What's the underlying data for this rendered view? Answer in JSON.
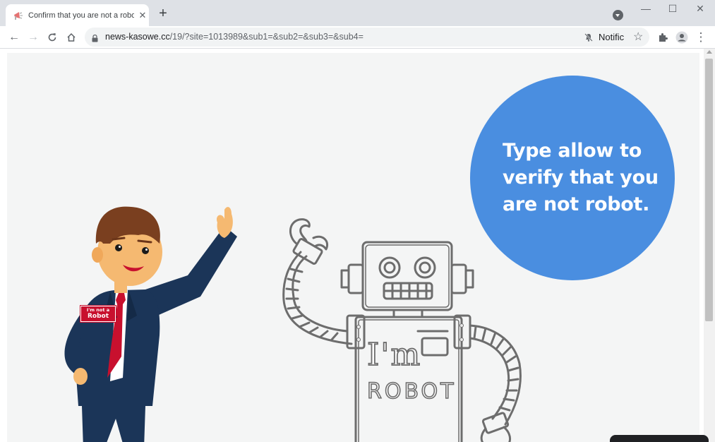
{
  "tab": {
    "title": "Confirm that you are not a robot",
    "close_glyph": "✕"
  },
  "newtab_glyph": "+",
  "window_controls": {
    "minimize": "—",
    "maximize": "☐",
    "close": "✕"
  },
  "nav": {
    "back": "←",
    "forward": "→"
  },
  "address": {
    "domain": "news-kasowe.cc",
    "path": "/19/?site=1013989&sub1=&sub2=&sub3=&sub4="
  },
  "notification_chip": "Notific",
  "bookmark_glyph": "☆",
  "menu_glyph": "⋮",
  "page": {
    "bubble_text": "Type allow to\nverify that you\nare not robot.",
    "badge_line1": "I'm not a",
    "badge_line2": "Robot",
    "robot_text1": "I'm",
    "robot_text2": "ROBOT"
  },
  "colors": {
    "bubble": "#4a8ee0",
    "suit": "#1b3558",
    "tie": "#c8102e",
    "page_bg": "#f4f5f5"
  }
}
